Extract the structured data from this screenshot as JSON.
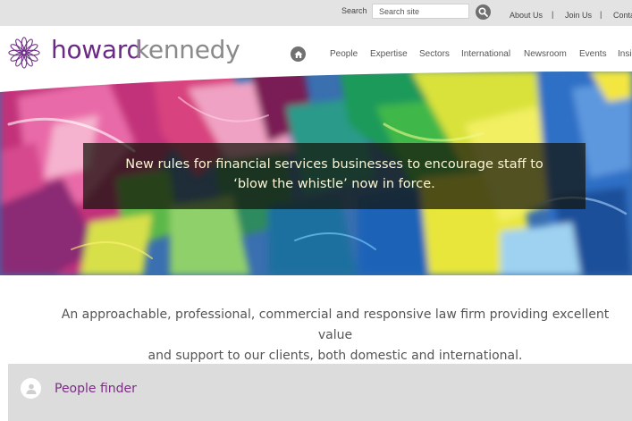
{
  "topbar": {
    "search_label": "Search",
    "search_placeholder": "Search site",
    "links": [
      "About Us",
      "Join Us",
      "Conta"
    ],
    "separators": [
      "|",
      "|"
    ]
  },
  "brand": {
    "name_part1": "howard",
    "name_part2": "kennedy",
    "color_primary": "#6b2a83",
    "color_secondary": "#8a8a8a"
  },
  "nav": {
    "items": [
      "People",
      "Expertise",
      "Sectors",
      "International",
      "Newsroom",
      "Events",
      "Insi"
    ]
  },
  "hero": {
    "headline_line1": "New rules for financial services businesses to encourage staff to",
    "headline_line2": "‘blow the whistle’ now in force."
  },
  "intro": {
    "line1": "An approachable, professional, commercial and responsive law firm providing excellent value",
    "line2": "and support to our clients, both domestic and international."
  },
  "people_finder": {
    "label": "People finder"
  },
  "icons": {
    "search": "search-icon",
    "home": "home-icon",
    "person": "person-icon",
    "logo": "logo-flower-icon"
  }
}
